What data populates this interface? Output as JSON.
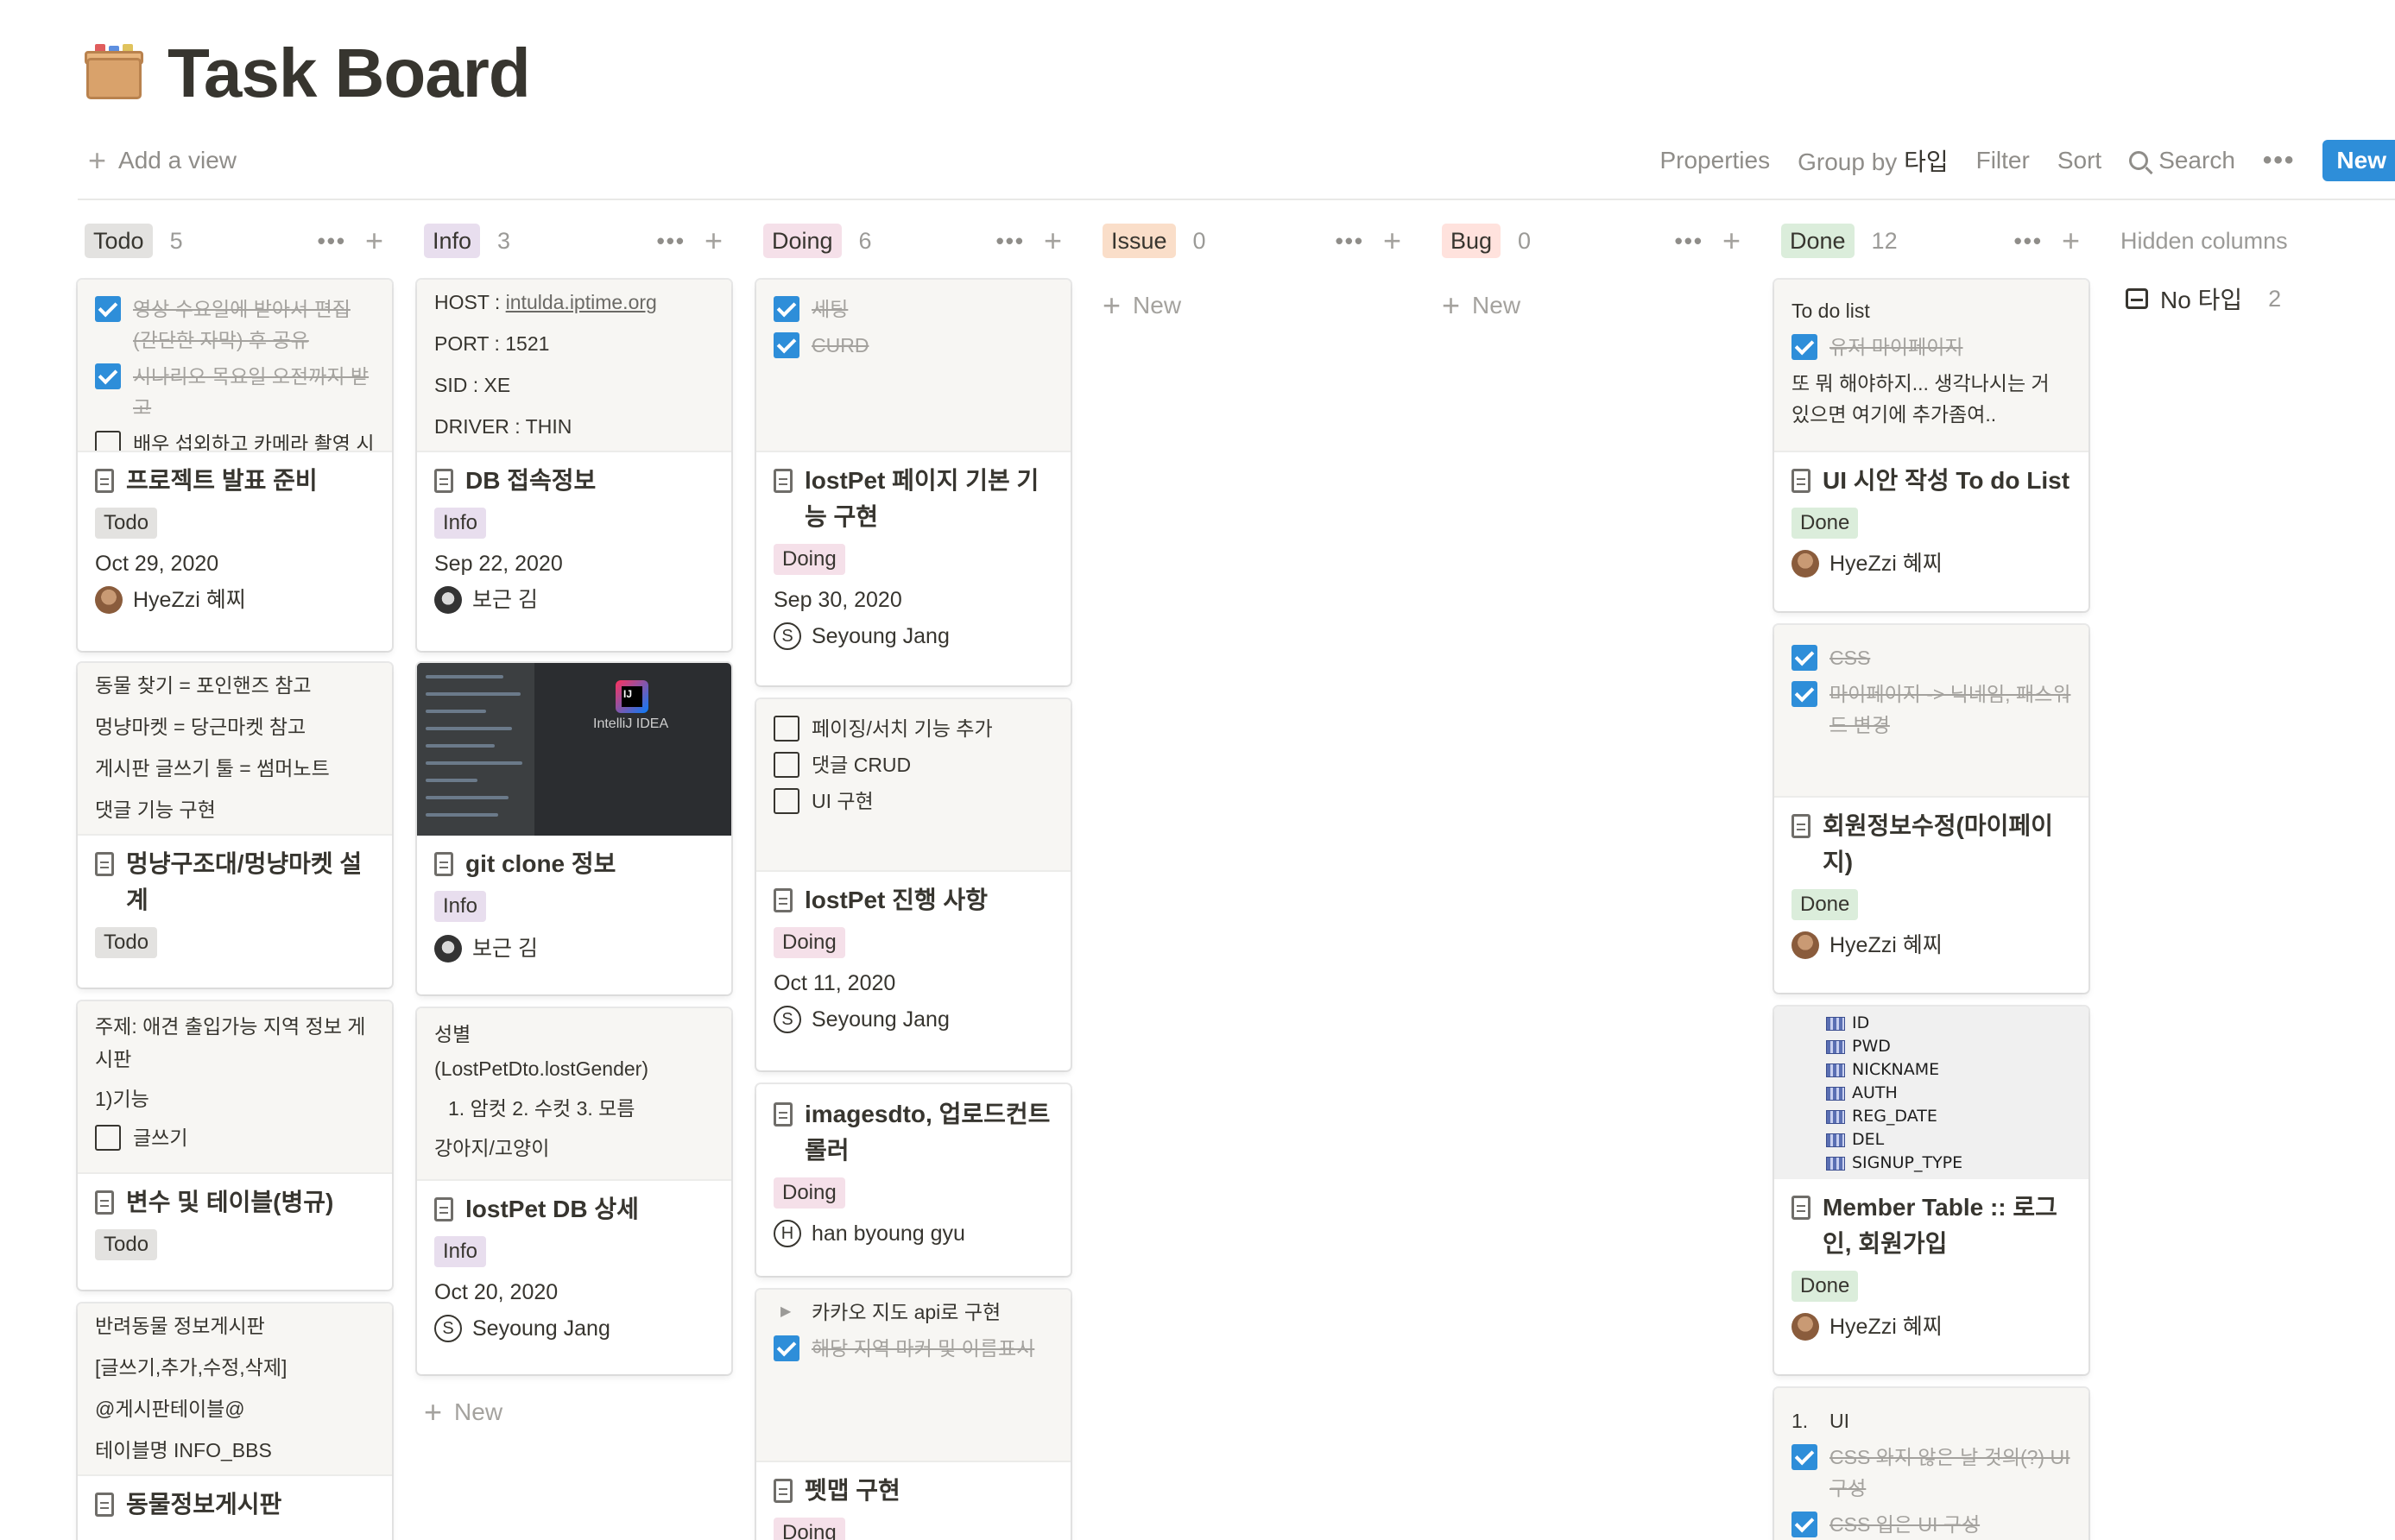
{
  "page": {
    "title": "Task Board",
    "icon": "card-index-box-icon"
  },
  "toolbar": {
    "add_view": "Add a view",
    "properties": "Properties",
    "group_by_label": "Group by",
    "group_by_value": "타입",
    "filter": "Filter",
    "sort": "Sort",
    "search": "Search",
    "more": "•••",
    "new": "New"
  },
  "colors": {
    "accent": "#2e8ed9",
    "todo_bg": "#e3e2e0",
    "info_bg": "#e8deee",
    "doing_bg": "#f5e0e9",
    "issue_bg": "#fadec9",
    "bug_bg": "#ffe2dd",
    "done_bg": "#dbeddb"
  },
  "columns": [
    {
      "name": "Todo",
      "count": "5"
    },
    {
      "name": "Info",
      "count": "3"
    },
    {
      "name": "Doing",
      "count": "6"
    },
    {
      "name": "Issue",
      "count": "0"
    },
    {
      "name": "Bug",
      "count": "0"
    },
    {
      "name": "Done",
      "count": "12"
    }
  ],
  "col_new_label": "New",
  "hidden": {
    "title": "Hidden columns",
    "item_label": "No 타입",
    "item_count": "2"
  },
  "todo": {
    "c1": {
      "preview": [
        "영상 수요일에 받아서 편집 (간단한 자막) 후 공유",
        "시나리오 목요일 오전까지 받고",
        "배우 섭외하고 카메라 촬영 시간"
      ],
      "title": "프로젝트 발표 준비",
      "tag": "Todo",
      "date": "Oct 29, 2020",
      "person": "HyeZzi 혜찌"
    },
    "c2": {
      "preview": [
        "동물 찾기 = 포인핸즈 참고",
        "멍냥마켓 = 당근마켓 참고",
        "게시판 글쓰기 툴 = 썸머노트",
        "댓글 기능 구현"
      ],
      "title": "멍냥구조대/멍냥마켓 설계",
      "tag": "Todo"
    },
    "c3": {
      "preview": [
        "주제: 애견 출입가능 지역 정보 게시판",
        "1)기능",
        "글쓰기"
      ],
      "title": "변수 및 테이블(병규)",
      "tag": "Todo"
    },
    "c4": {
      "preview": [
        "반려동물 정보게시판",
        "[글쓰기,추가,수정,삭제]",
        "@게시판테이블@",
        "테이블명 INFO_BBS"
      ],
      "title": "동물정보게시판"
    }
  },
  "info": {
    "c1": {
      "preview": [
        "HOST : ",
        "intulda.iptime.org",
        "PORT : 1521",
        "SID : XE",
        "DRIVER : THIN"
      ],
      "title": "DB 접속정보",
      "tag": "Info",
      "date": "Sep 22, 2020",
      "person": "보근 김"
    },
    "c2": {
      "preview_app": "IntelliJ IDEA",
      "title": "git clone 정보",
      "tag": "Info",
      "person": "보근 김"
    },
    "c3": {
      "preview": [
        "성별",
        "(LostPetDto.lostGender)",
        "1.   암컷 2. 수컷 3. 모름",
        "강아지/고양이"
      ],
      "title": "lostPet DB 상세",
      "tag": "Info",
      "date": "Oct 20, 2020",
      "person": "Seyoung Jang",
      "person_initial": "S"
    }
  },
  "doing": {
    "c1": {
      "preview": [
        "세팅",
        "CURD"
      ],
      "title": "lostPet 페이지 기본 기능 구현",
      "tag": "Doing",
      "date": "Sep 30, 2020",
      "person": "Seyoung Jang",
      "person_initial": "S"
    },
    "c2": {
      "preview": [
        "페이징/서치 기능 추가",
        "댓글 CRUD",
        "UI 구현"
      ],
      "title": "lostPet 진행 사항",
      "tag": "Doing",
      "date": "Oct 11, 2020",
      "person": "Seyoung Jang",
      "person_initial": "S"
    },
    "c3": {
      "title": "imagesdto, 업로드컨트롤러",
      "tag": "Doing",
      "person": "han byoung gyu",
      "person_initial": "H"
    },
    "c4": {
      "preview": [
        "카카오 지도 api로 구현",
        "해당 지역 마커 및 이름표시"
      ],
      "title": "펫맵 구현",
      "tag": "Doing"
    }
  },
  "done": {
    "c1": {
      "preview": [
        "To do list",
        "유저 마이페이지",
        "또 뭐 해야하지... 생각나시는 거 있으면 여기에 추가좀여.."
      ],
      "title": "UI 시안 작성 To do List",
      "tag": "Done",
      "person": "HyeZzi 혜찌"
    },
    "c2": {
      "preview": [
        "CSS",
        "마이페이지 -> 닉네임, 패스워드 변경"
      ],
      "title": "회원정보수정(마이페이지)",
      "tag": "Done",
      "person": "HyeZzi 혜찌"
    },
    "c3": {
      "preview": [
        "ID",
        "PWD",
        "NICKNAME",
        "AUTH",
        "REG_DATE",
        "DEL",
        "SIGNUP_TYPE"
      ],
      "title": "Member Table :: 로그인, 회원가입",
      "tag": "Done",
      "person": "HyeZzi 혜찌"
    },
    "c4": {
      "preview": [
        "1.",
        "UI",
        "CSS 와지 않은 날 것의(?) UI 구성",
        "CSS 입은 UI 구성"
      ]
    }
  }
}
